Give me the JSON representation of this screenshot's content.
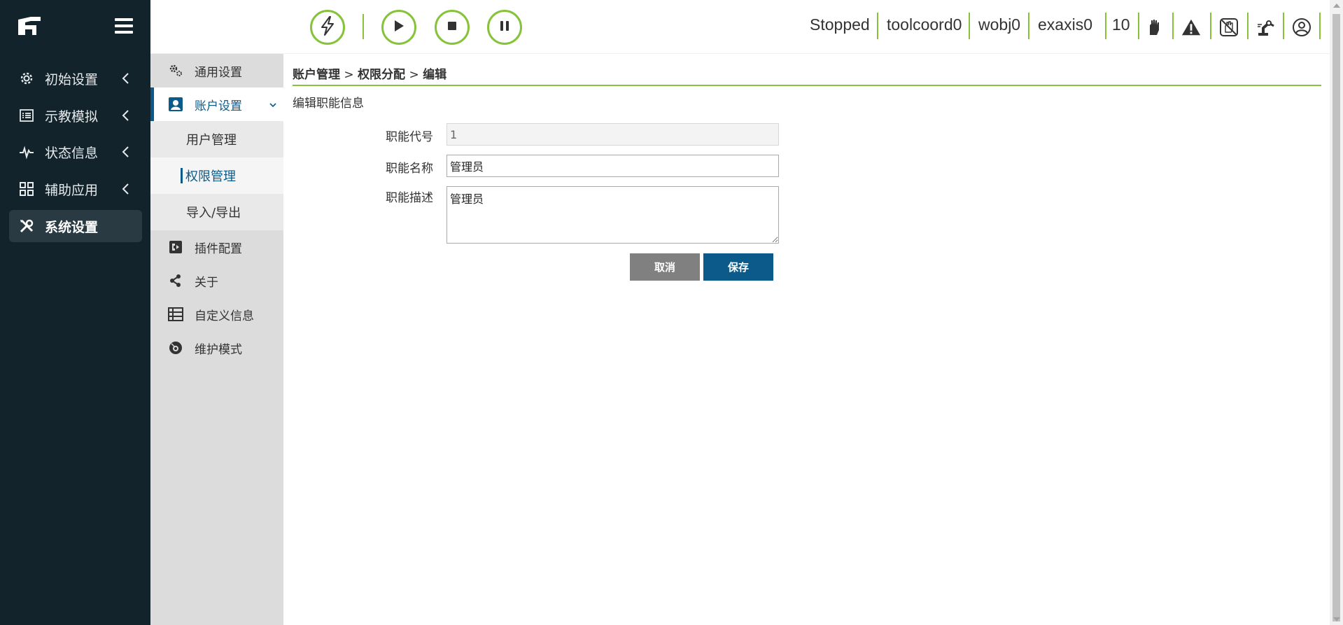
{
  "sidebar": {
    "items": [
      {
        "label": "初始设置",
        "icon": "gear-icon"
      },
      {
        "label": "示教模拟",
        "icon": "list-icon"
      },
      {
        "label": "状态信息",
        "icon": "pulse-icon"
      },
      {
        "label": "辅助应用",
        "icon": "grid-icon"
      },
      {
        "label": "系统设置",
        "icon": "tools-icon"
      }
    ]
  },
  "submenu": {
    "items": [
      {
        "label": "通用设置",
        "icon": "gears-icon"
      },
      {
        "label": "账户设置",
        "icon": "user-badge-icon"
      },
      {
        "label": "插件配置",
        "icon": "plugin-icon"
      },
      {
        "label": "关于",
        "icon": "share-icon"
      },
      {
        "label": "自定义信息",
        "icon": "table-icon"
      },
      {
        "label": "维护模式",
        "icon": "maintenance-icon"
      }
    ],
    "children": [
      {
        "label": "用户管理"
      },
      {
        "label": "权限管理"
      },
      {
        "label": "导入/导出"
      }
    ]
  },
  "topbar": {
    "status": "Stopped",
    "toolcoord": "toolcoord0",
    "wobj": "wobj0",
    "exaxis": "exaxis0",
    "speed": "10",
    "accent": "#86c33a"
  },
  "breadcrumb": {
    "part1": "账户管理",
    "sep1": " > ",
    "part2": "权限分配",
    "sep2": " > ",
    "part3": "编辑"
  },
  "form": {
    "title": "编辑职能信息",
    "code_label": "职能代号",
    "code_value": "1",
    "name_label": "职能名称",
    "name_value": "管理员",
    "desc_label": "职能描述",
    "desc_value": "管理员",
    "cancel": "取消",
    "save": "保存"
  },
  "colors": {
    "sidebar_bg": "#12232b",
    "primary": "#0b5a8a",
    "accent": "#86c33a"
  }
}
